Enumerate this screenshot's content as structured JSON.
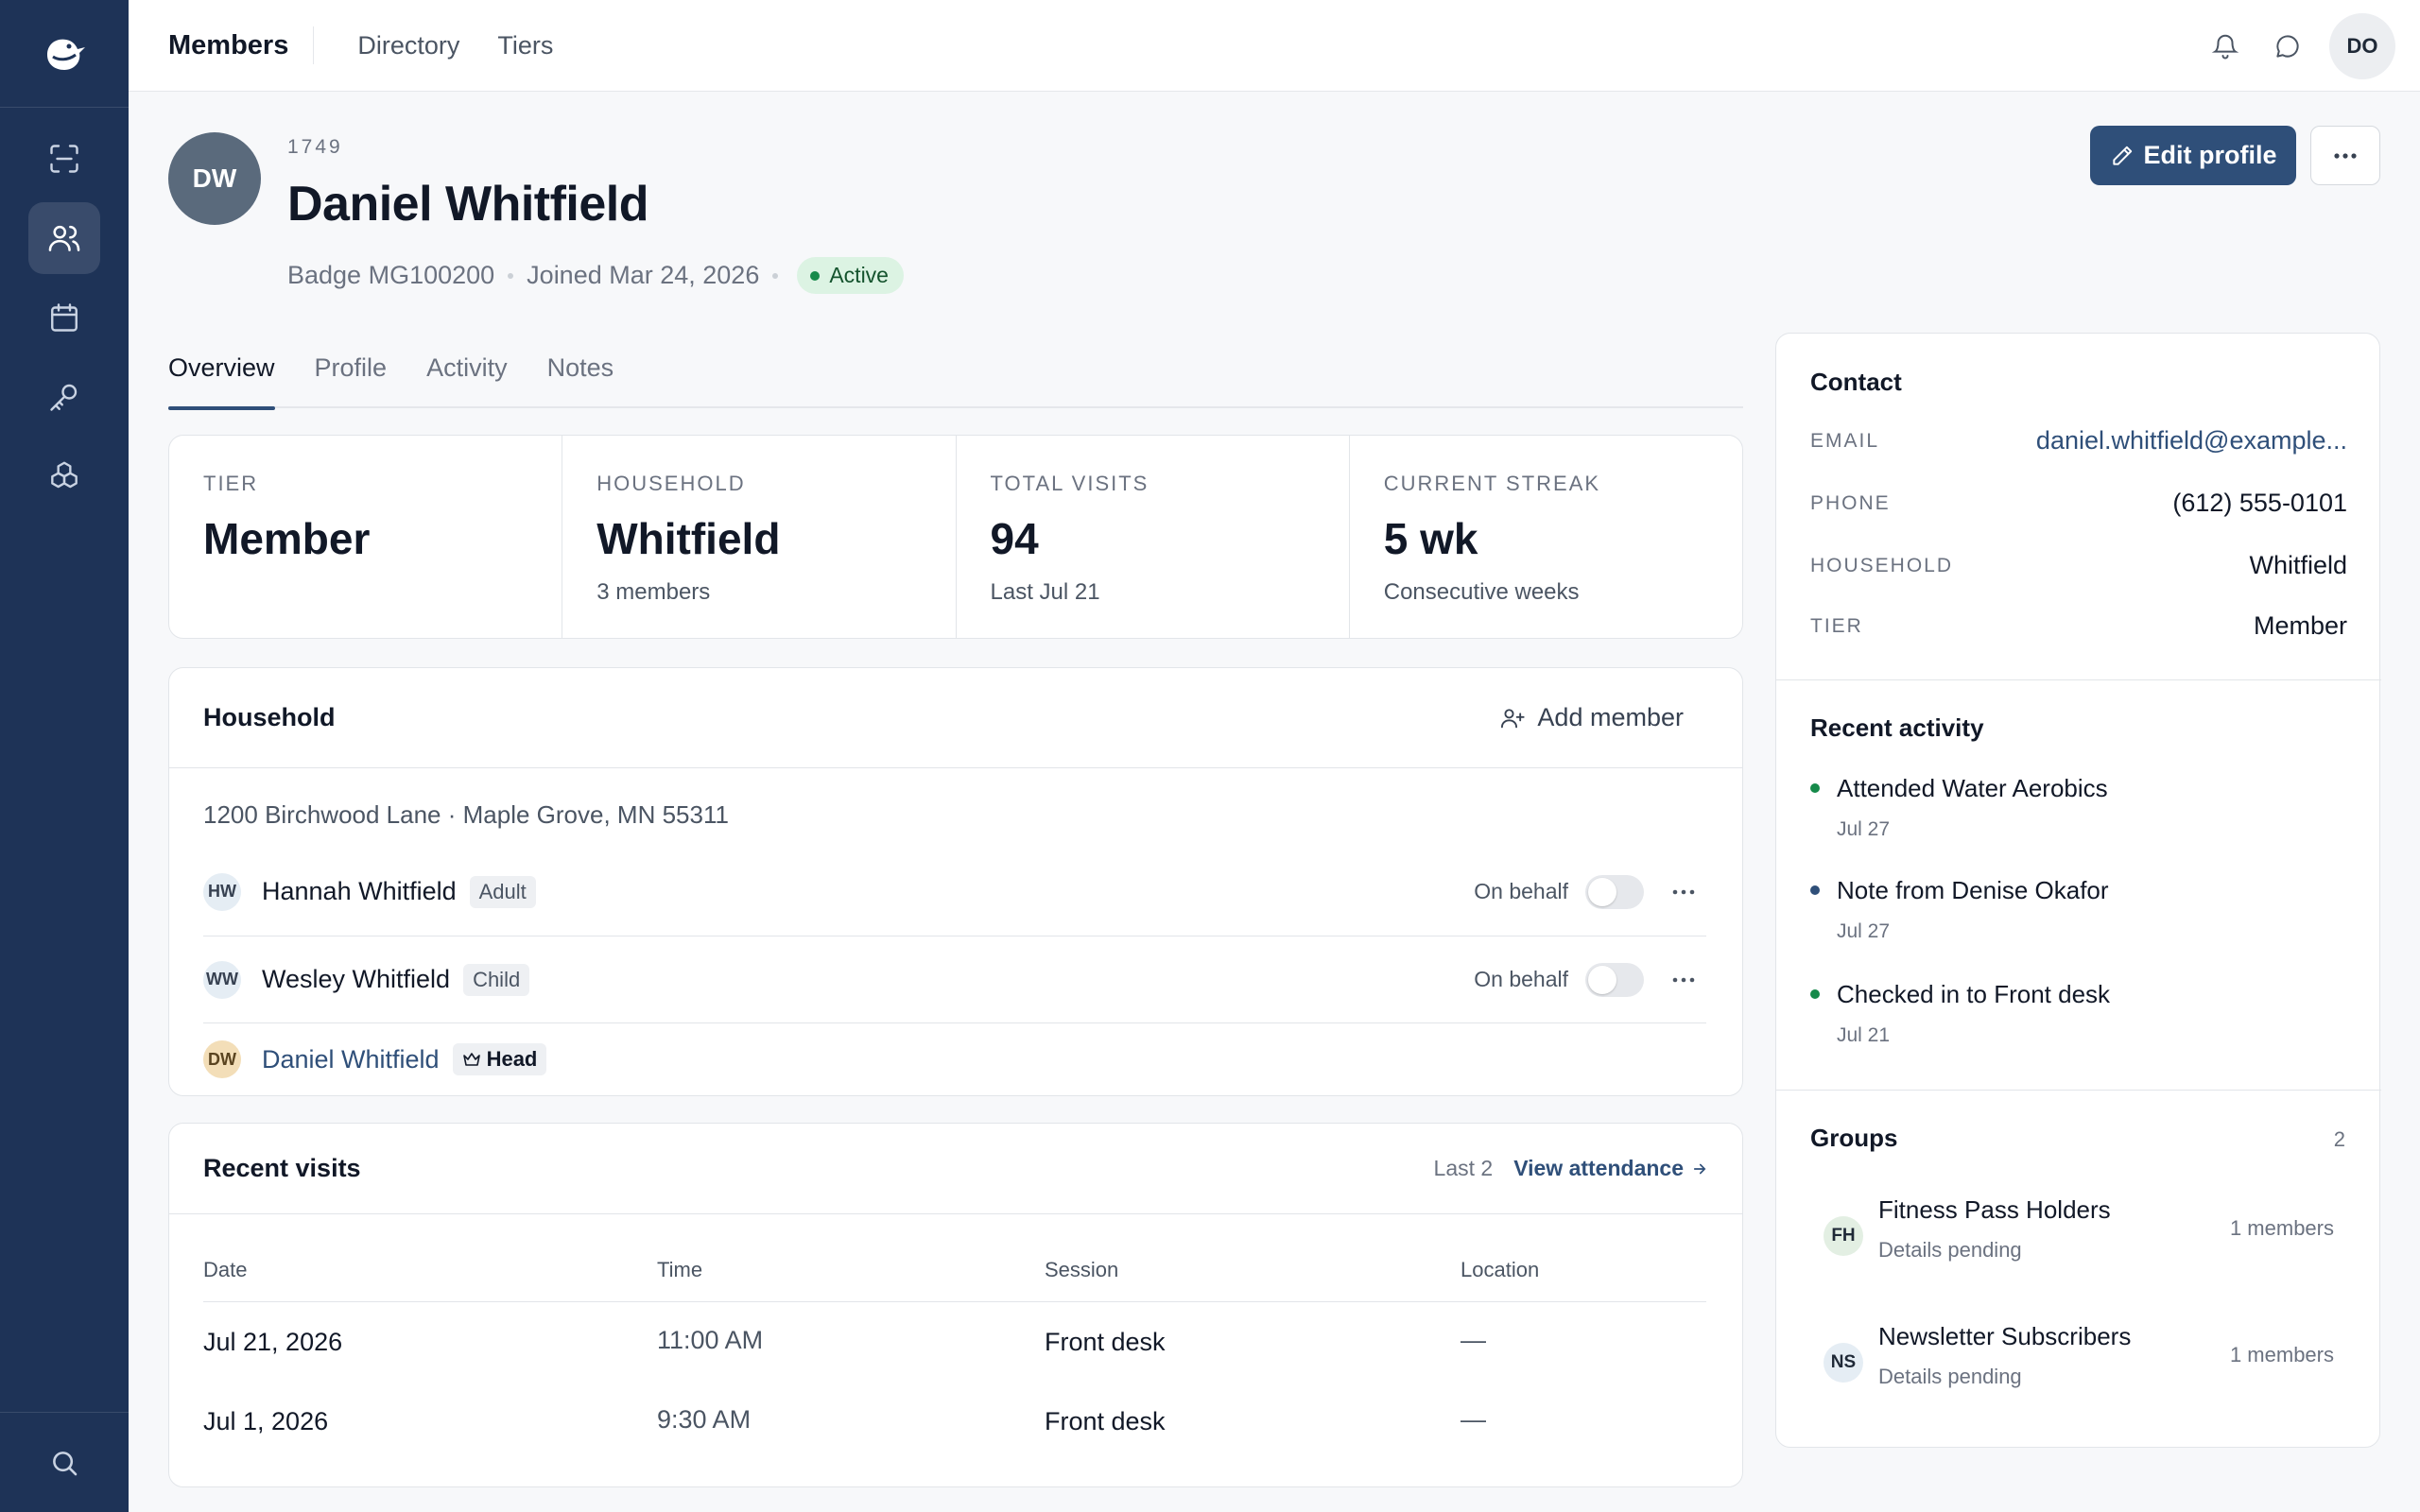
{
  "topbar": {
    "title": "Members",
    "links": [
      "Directory",
      "Tiers"
    ],
    "user_initials": "DO"
  },
  "sidebar": {
    "items": [
      {
        "icon": "scan-icon",
        "active": false
      },
      {
        "icon": "users-icon",
        "active": true
      },
      {
        "icon": "calendar-icon",
        "active": false
      },
      {
        "icon": "key-icon",
        "active": false
      },
      {
        "icon": "boxes-icon",
        "active": false
      }
    ],
    "bottom_icon": "search-icon"
  },
  "member": {
    "initials": "DW",
    "id": "1749",
    "name": "Daniel Whitfield",
    "badge": "Badge MG100200",
    "joined": "Joined Mar 24, 2026",
    "status": "Active",
    "edit_label": "Edit profile"
  },
  "tabs": [
    "Overview",
    "Profile",
    "Activity",
    "Notes"
  ],
  "stats": [
    {
      "label": "TIER",
      "value": "Member",
      "sub": ""
    },
    {
      "label": "HOUSEHOLD",
      "value": "Whitfield",
      "sub": "3 members"
    },
    {
      "label": "TOTAL VISITS",
      "value": "94",
      "sub": "Last Jul 21"
    },
    {
      "label": "CURRENT STREAK",
      "value": "5 wk",
      "sub": "Consecutive weeks"
    }
  ],
  "household": {
    "title": "Household",
    "add_label": "Add member",
    "address": "1200 Birchwood Lane · Maple Grove, MN 55311",
    "on_behalf_label": "On behalf",
    "members": [
      {
        "initials": "HW",
        "name": "Hannah Whitfield",
        "role": "Adult"
      },
      {
        "initials": "WW",
        "name": "Wesley Whitfield",
        "role": "Child"
      },
      {
        "initials": "DW",
        "name": "Daniel Whitfield",
        "role": "Head"
      }
    ]
  },
  "visits": {
    "title": "Recent visits",
    "last_label": "Last 2",
    "view_label": "View attendance",
    "columns": [
      "Date",
      "Time",
      "Session",
      "Location"
    ],
    "rows": [
      [
        "Jul 21, 2026",
        "11:00 AM",
        "Front desk",
        "—"
      ],
      [
        "Jul 1, 2026",
        "9:30 AM",
        "Front desk",
        "—"
      ]
    ]
  },
  "contact": {
    "title": "Contact",
    "rows": [
      {
        "label": "EMAIL",
        "value": "daniel.whitfield@example..."
      },
      {
        "label": "PHONE",
        "value": "(612) 555-0101"
      },
      {
        "label": "HOUSEHOLD",
        "value": "Whitfield"
      },
      {
        "label": "TIER",
        "value": "Member"
      }
    ]
  },
  "recent_activity": {
    "title": "Recent activity",
    "items": [
      {
        "text": "Attended Water Aerobics",
        "date": "Jul 27"
      },
      {
        "text": "Note from Denise Okafor",
        "date": "Jul 27"
      },
      {
        "text": "Checked in to Front desk",
        "date": "Jul 21"
      }
    ]
  },
  "groups": {
    "title": "Groups",
    "count": "2",
    "items": [
      {
        "initials": "FH",
        "name": "Fitness Pass Holders",
        "sub": "Details pending",
        "members": "1 members"
      },
      {
        "initials": "NS",
        "name": "Newsletter Subscribers",
        "sub": "Details pending",
        "members": "1 members"
      }
    ]
  },
  "colors": {
    "sidebar": "#1e3357",
    "accent": "#2f4f79",
    "active_green": "#168a4a"
  }
}
